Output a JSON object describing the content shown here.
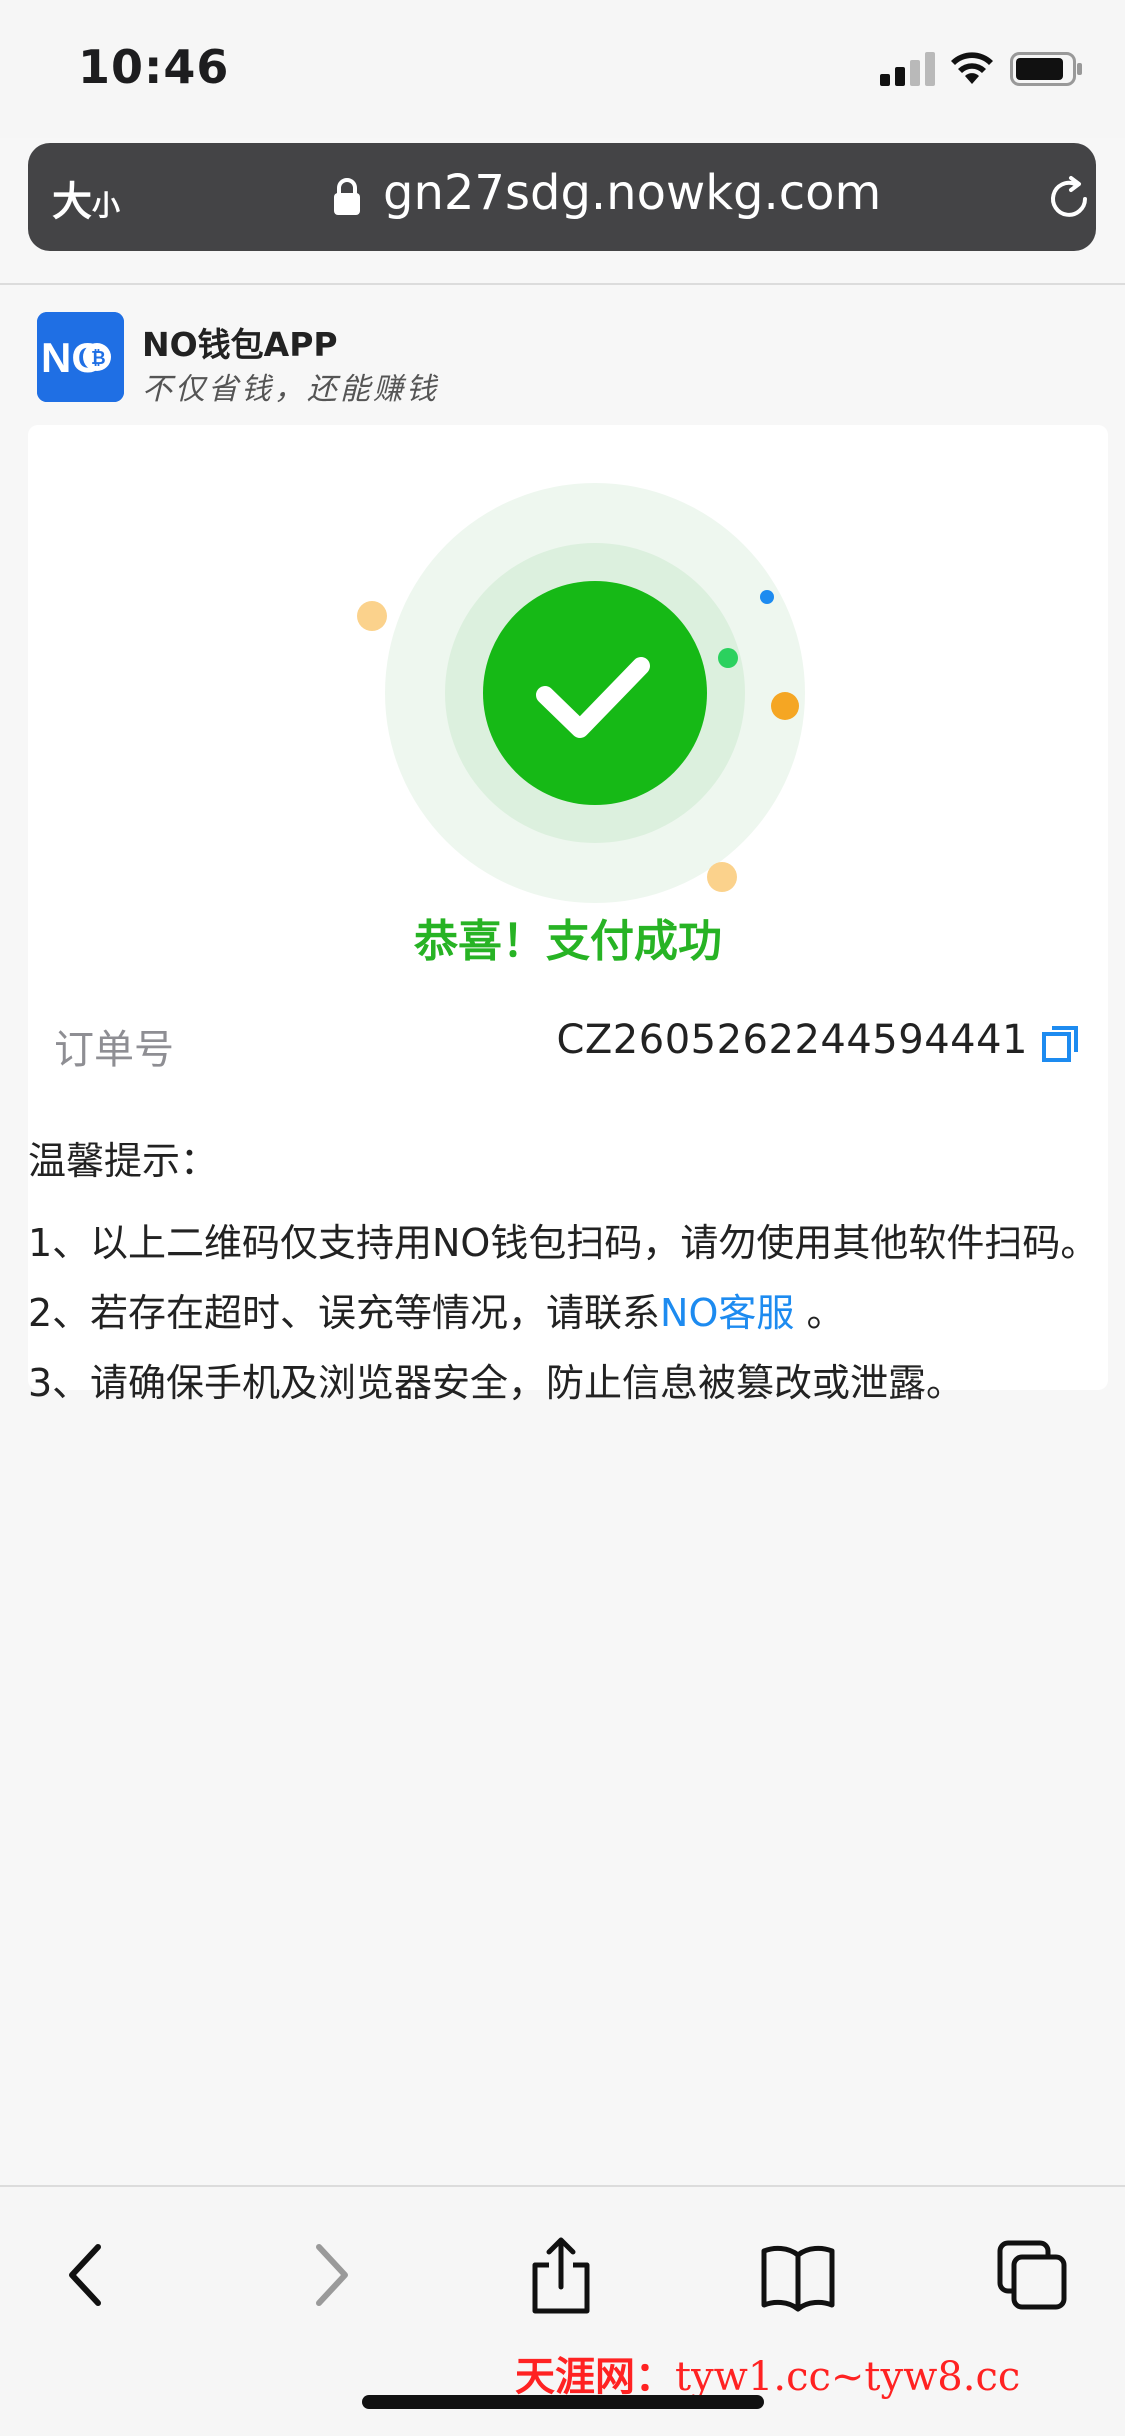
{
  "status_bar": {
    "time": "10:46"
  },
  "address_bar": {
    "text_size_big": "大",
    "text_size_small": "小",
    "url": "gn27sdg.nowkg.com"
  },
  "app": {
    "logo_text": "NO",
    "name": "NO钱包APP",
    "slogan": "不仅省钱，还能赚钱",
    "brand_color": "#1f6fe4"
  },
  "result": {
    "title": "恭喜！支付成功",
    "accent_color": "#27b324",
    "order_label": "订单号",
    "order_number": "CZ2605262244594441"
  },
  "tips": {
    "heading": "温馨提示：",
    "items": [
      {
        "num": "1、",
        "text": "以上二维码仅支持用NO钱包扫码，请勿使用其他软件扫码。"
      },
      {
        "num": "2、",
        "text_before": "若存在超时、误充等情况，请联系",
        "link": "NO客服",
        "text_after": " 。"
      },
      {
        "num": "3、",
        "text": "请确保手机及浏览器安全，防止信息被篡改或泄露。"
      }
    ]
  },
  "toolbar": {
    "icons": [
      "back-icon",
      "forward-icon",
      "share-icon",
      "bookmarks-icon",
      "tabs-icon"
    ]
  },
  "watermark": {
    "brand": "天涯网：",
    "domains": "tyw1.cc~tyw8.cc"
  }
}
